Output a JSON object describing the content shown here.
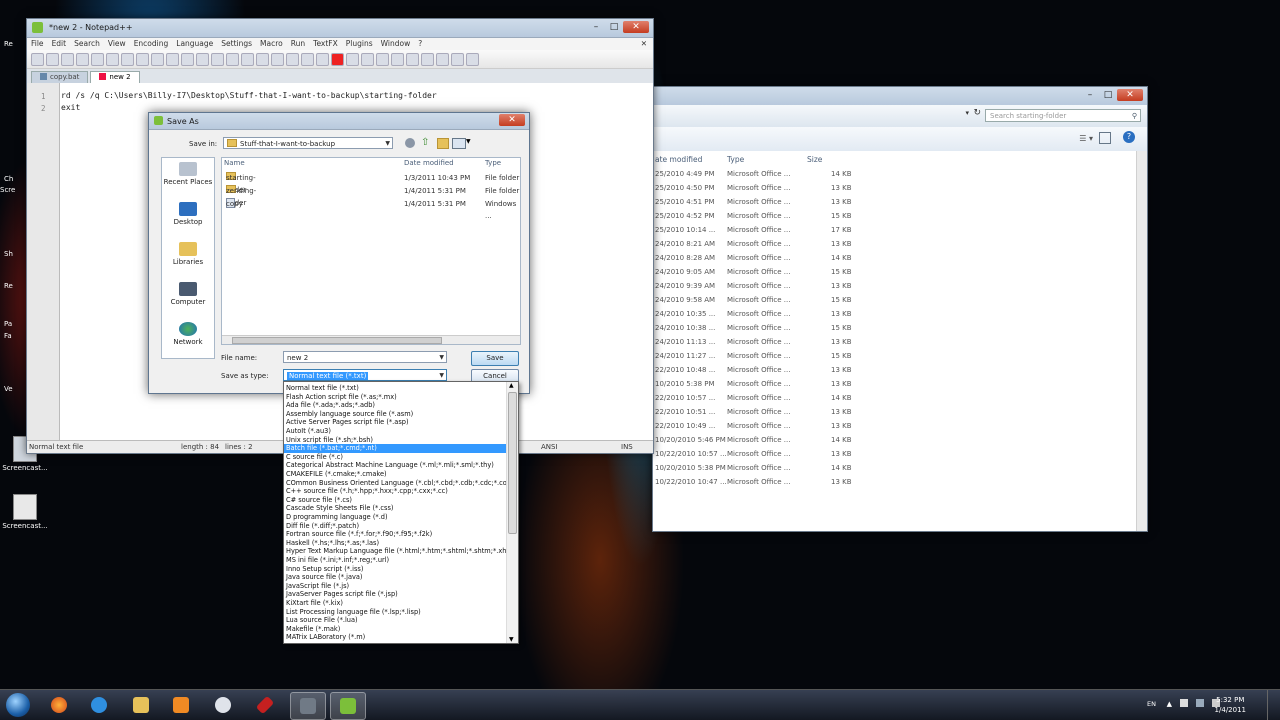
{
  "desktop": {
    "left_edge_labels": [
      "Re",
      "Ch",
      "Scre",
      "Sh",
      "Re",
      "Pa",
      "Fa",
      "Ve"
    ],
    "icons": [
      {
        "label": "Screencast..."
      },
      {
        "label": "Screencast..."
      }
    ]
  },
  "notepad": {
    "title": "*new  2 - Notepad++",
    "menu": [
      "File",
      "Edit",
      "Search",
      "View",
      "Encoding",
      "Language",
      "Settings",
      "Macro",
      "Run",
      "TextFX",
      "Plugins",
      "Window",
      "?"
    ],
    "tabs": [
      {
        "label": "copy.bat",
        "active": false
      },
      {
        "label": "new  2",
        "active": true
      }
    ],
    "lines": [
      {
        "num": "1",
        "text": "rd /s /q C:\\Users\\Billy-I7\\Desktop\\Stuff-that-I-want-to-backup\\starting-folder"
      },
      {
        "num": "2",
        "text": "exit"
      }
    ],
    "status": {
      "type": "Normal text file",
      "length": "length : 84",
      "lines": "lines : 2",
      "encoding": "ANSI",
      "mode": "INS"
    }
  },
  "explorer": {
    "search_placeholder": "Search starting-folder",
    "columns": [
      "ate modified",
      "Type",
      "Size"
    ],
    "rows": [
      {
        "date": "25/2010 4:49 PM",
        "type": "Microsoft Office ...",
        "size": "14 KB"
      },
      {
        "date": "25/2010 4:50 PM",
        "type": "Microsoft Office ...",
        "size": "13 KB"
      },
      {
        "date": "25/2010 4:51 PM",
        "type": "Microsoft Office ...",
        "size": "13 KB"
      },
      {
        "date": "25/2010 4:52 PM",
        "type": "Microsoft Office ...",
        "size": "15 KB"
      },
      {
        "date": "25/2010 10:14 ...",
        "type": "Microsoft Office ...",
        "size": "17 KB"
      },
      {
        "date": "24/2010 8:21 AM",
        "type": "Microsoft Office ...",
        "size": "13 KB"
      },
      {
        "date": "24/2010 8:28 AM",
        "type": "Microsoft Office ...",
        "size": "14 KB"
      },
      {
        "date": "24/2010 9:05 AM",
        "type": "Microsoft Office ...",
        "size": "15 KB"
      },
      {
        "date": "24/2010 9:39 AM",
        "type": "Microsoft Office ...",
        "size": "13 KB"
      },
      {
        "date": "24/2010 9:58 AM",
        "type": "Microsoft Office ...",
        "size": "15 KB"
      },
      {
        "date": "24/2010 10:35 ...",
        "type": "Microsoft Office ...",
        "size": "13 KB"
      },
      {
        "date": "24/2010 10:38 ...",
        "type": "Microsoft Office ...",
        "size": "15 KB"
      },
      {
        "date": "24/2010 11:13 ...",
        "type": "Microsoft Office ...",
        "size": "13 KB"
      },
      {
        "date": "24/2010 11:27 ...",
        "type": "Microsoft Office ...",
        "size": "15 KB"
      },
      {
        "date": "22/2010 10:48 ...",
        "type": "Microsoft Office ...",
        "size": "13 KB"
      },
      {
        "date": "10/2010 5:38 PM",
        "type": "Microsoft Office ...",
        "size": "13 KB"
      },
      {
        "date": "22/2010 10:57 ...",
        "type": "Microsoft Office ...",
        "size": "14 KB"
      },
      {
        "date": "22/2010 10:51 ...",
        "type": "Microsoft Office ...",
        "size": "13 KB"
      },
      {
        "date": "22/2010 10:49 ...",
        "type": "Microsoft Office ...",
        "size": "13 KB"
      },
      {
        "date": "10/20/2010 5:46 PM",
        "type": "Microsoft Office ...",
        "size": "14 KB"
      },
      {
        "date": "10/22/2010 10:57 ...",
        "type": "Microsoft Office ...",
        "size": "13 KB"
      },
      {
        "date": "10/20/2010 5:38 PM",
        "type": "Microsoft Office ...",
        "size": "14 KB"
      },
      {
        "date": "10/22/2010 10:47 ...",
        "type": "Microsoft Office ...",
        "size": "13 KB"
      }
    ]
  },
  "save_dialog": {
    "title": "Save As",
    "save_in_label": "Save in:",
    "save_in_value": "Stuff-that-I-want-to-backup",
    "places": [
      "Recent Places",
      "Desktop",
      "Libraries",
      "Computer",
      "Network"
    ],
    "columns": [
      "Name",
      "Date modified",
      "Type"
    ],
    "files": [
      {
        "name": "starting-folder",
        "date": "1/3/2011 10:43 PM",
        "type": "File folder",
        "kind": "folder"
      },
      {
        "name": "zending-folder",
        "date": "1/4/2011 5:31 PM",
        "type": "File folder",
        "kind": "folder"
      },
      {
        "name": "copy",
        "date": "1/4/2011 5:31 PM",
        "type": "Windows ...",
        "kind": "batch"
      }
    ],
    "file_name_label": "File name:",
    "file_name_value": "new  2",
    "save_as_type_label": "Save as type:",
    "save_as_type_value": "Normal text file (*.txt)",
    "save_button": "Save",
    "cancel_button": "Cancel"
  },
  "type_options": [
    "Normal text file (*.txt)",
    "Flash Action script file (*.as;*.mx)",
    "Ada file (*.ada;*.ads;*.adb)",
    "Assembly language source file (*.asm)",
    "Active Server Pages script file (*.asp)",
    "AutoIt (*.au3)",
    "Unix script file (*.sh;*.bsh)",
    "Batch file (*.bat;*.cmd;*.nt)",
    "C source file (*.c)",
    "Categorical Abstract Machine Language (*.ml;*.mli;*.sml;*.thy)",
    "CMAKEFILE (*.cmake;*.cmake)",
    "COmmon Business Oriented Language (*.cbl;*.cbd;*.cdb;*.cdc;*.cob)",
    "C++ source file (*.h;*.hpp;*.hxx;*.cpp;*.cxx;*.cc)",
    "C# source file (*.cs)",
    "Cascade Style Sheets File (*.css)",
    "D programming language (*.d)",
    "Diff file (*.diff;*.patch)",
    "Fortran source file (*.f;*.for;*.f90;*.f95;*.f2k)",
    "Haskell (*.hs;*.lhs;*.as;*.las)",
    "Hyper Text Markup Language file (*.html;*.htm;*.shtml;*.shtm;*.xhtml)",
    "MS ini file (*.ini;*.inf;*.reg;*.url)",
    "Inno Setup script (*.iss)",
    "Java source file (*.java)",
    "JavaScript file (*.js)",
    "JavaServer Pages script file (*.jsp)",
    "KiXtart file (*.kix)",
    "List Processing language file (*.lsp;*.lisp)",
    "Lua source File (*.lua)",
    "Makefile (*.mak)",
    "MATrix LABoratory (*.m)"
  ],
  "selected_type_index": 7,
  "taskbar": {
    "language": "EN",
    "time": "5:32 PM",
    "date": "1/4/2011"
  }
}
